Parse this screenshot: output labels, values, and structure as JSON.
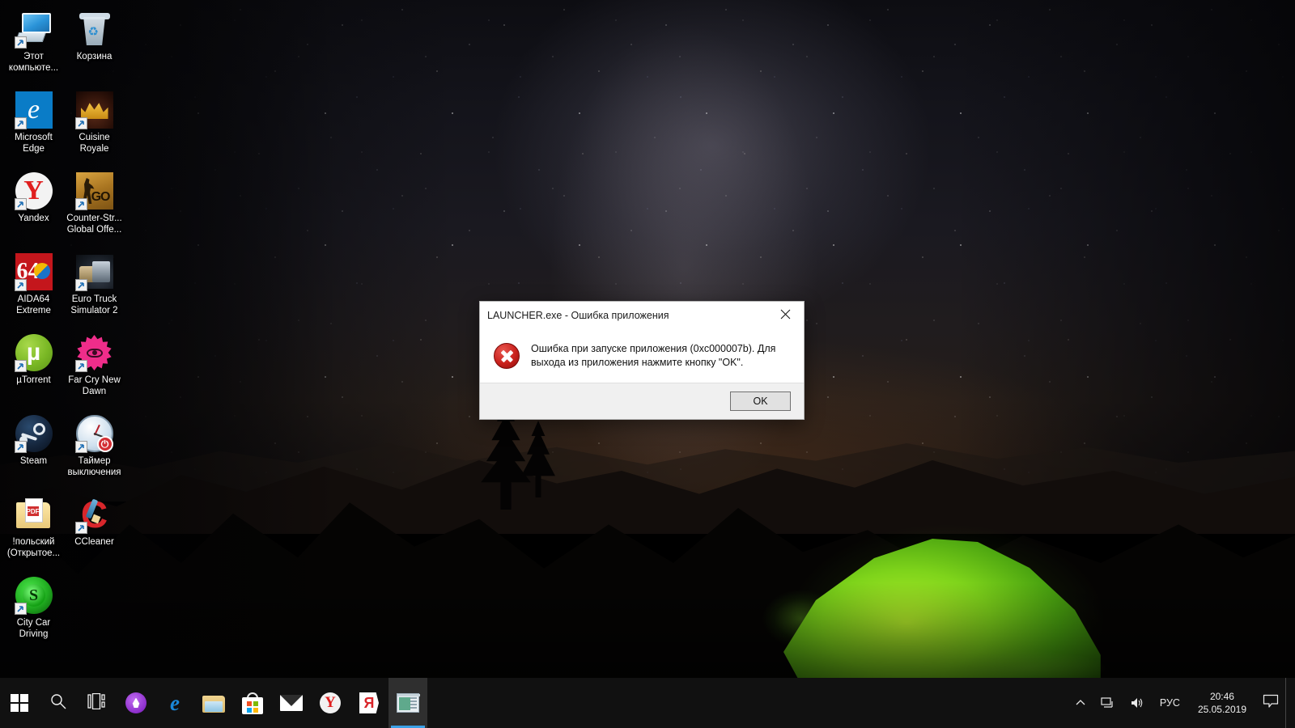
{
  "desktop": {
    "wallpaper_description": "Night sky with Milky Way over mountain silhouettes and glowing green tent",
    "icons": [
      {
        "label": "Этот компьюте...",
        "name": "this-pc",
        "art": "pc",
        "shortcut": true
      },
      {
        "label": "Корзина",
        "name": "recycle-bin",
        "art": "bin",
        "shortcut": false
      },
      {
        "label": "Microsoft Edge",
        "name": "microsoft-edge",
        "art": "edge",
        "shortcut": true
      },
      {
        "label": "Cuisine Royale",
        "name": "cuisine-royale",
        "art": "cuisine",
        "shortcut": true
      },
      {
        "label": "Yandex",
        "name": "yandex",
        "art": "yandex",
        "shortcut": true
      },
      {
        "label": "Counter-Str... Global Offe...",
        "name": "counter-strike-global-offensive",
        "art": "csgo",
        "shortcut": true
      },
      {
        "label": "AIDA64 Extreme",
        "name": "aida64-extreme",
        "art": "aida",
        "shortcut": true
      },
      {
        "label": "Euro Truck Simulator 2",
        "name": "euro-truck-simulator-2",
        "art": "truck",
        "shortcut": true
      },
      {
        "label": "µTorrent",
        "name": "utorrent",
        "art": "utorrent",
        "shortcut": true
      },
      {
        "label": "Far Cry New Dawn",
        "name": "far-cry-new-dawn",
        "art": "farcry",
        "shortcut": true
      },
      {
        "label": "Steam",
        "name": "steam",
        "art": "steam",
        "shortcut": true
      },
      {
        "label": "Таймер выключения",
        "name": "shutdown-timer",
        "art": "timer",
        "shortcut": true
      },
      {
        "label": "!польский (Открытое...",
        "name": "polish-folder",
        "art": "folderdoc",
        "shortcut": false
      },
      {
        "label": "CCleaner",
        "name": "ccleaner",
        "art": "ccleaner",
        "shortcut": true
      },
      {
        "label": "City Car Driving",
        "name": "city-car-driving",
        "art": "citycar",
        "shortcut": true
      }
    ]
  },
  "dialog": {
    "title": "LAUNCHER.exe - Ошибка приложения",
    "message": "Ошибка при запуске приложения (0xc000007b). Для выхода из приложения нажмите кнопку \"OK\".",
    "ok_label": "OK",
    "close_icon": "close-icon",
    "error_icon": "error-circle-x-icon",
    "error_code": "0xc000007b",
    "accent_error_color": "#c9211c"
  },
  "taskbar": {
    "start_label": "Пуск",
    "search_label": "Поиск",
    "taskview_label": "Представление задач",
    "apps": [
      {
        "name": "alice-assistant",
        "label": "Алиса"
      },
      {
        "name": "microsoft-edge",
        "label": "Microsoft Edge"
      },
      {
        "name": "file-explorer",
        "label": "Проводник"
      },
      {
        "name": "microsoft-store",
        "label": "Microsoft Store"
      },
      {
        "name": "mail",
        "label": "Почта"
      },
      {
        "name": "yandex-browser",
        "label": "Yandex Browser"
      },
      {
        "name": "yandex",
        "label": "Яндекс"
      },
      {
        "name": "launcher-window",
        "label": "LAUNCHER.exe",
        "active": true
      }
    ],
    "tray": {
      "overflow_label": "Отображать скрытые значки",
      "network_label": "Сеть",
      "volume_label": "Громкость",
      "language": "РУС",
      "time": "20:46",
      "date": "25.05.2019",
      "action_center_label": "Центр уведомлений"
    }
  }
}
